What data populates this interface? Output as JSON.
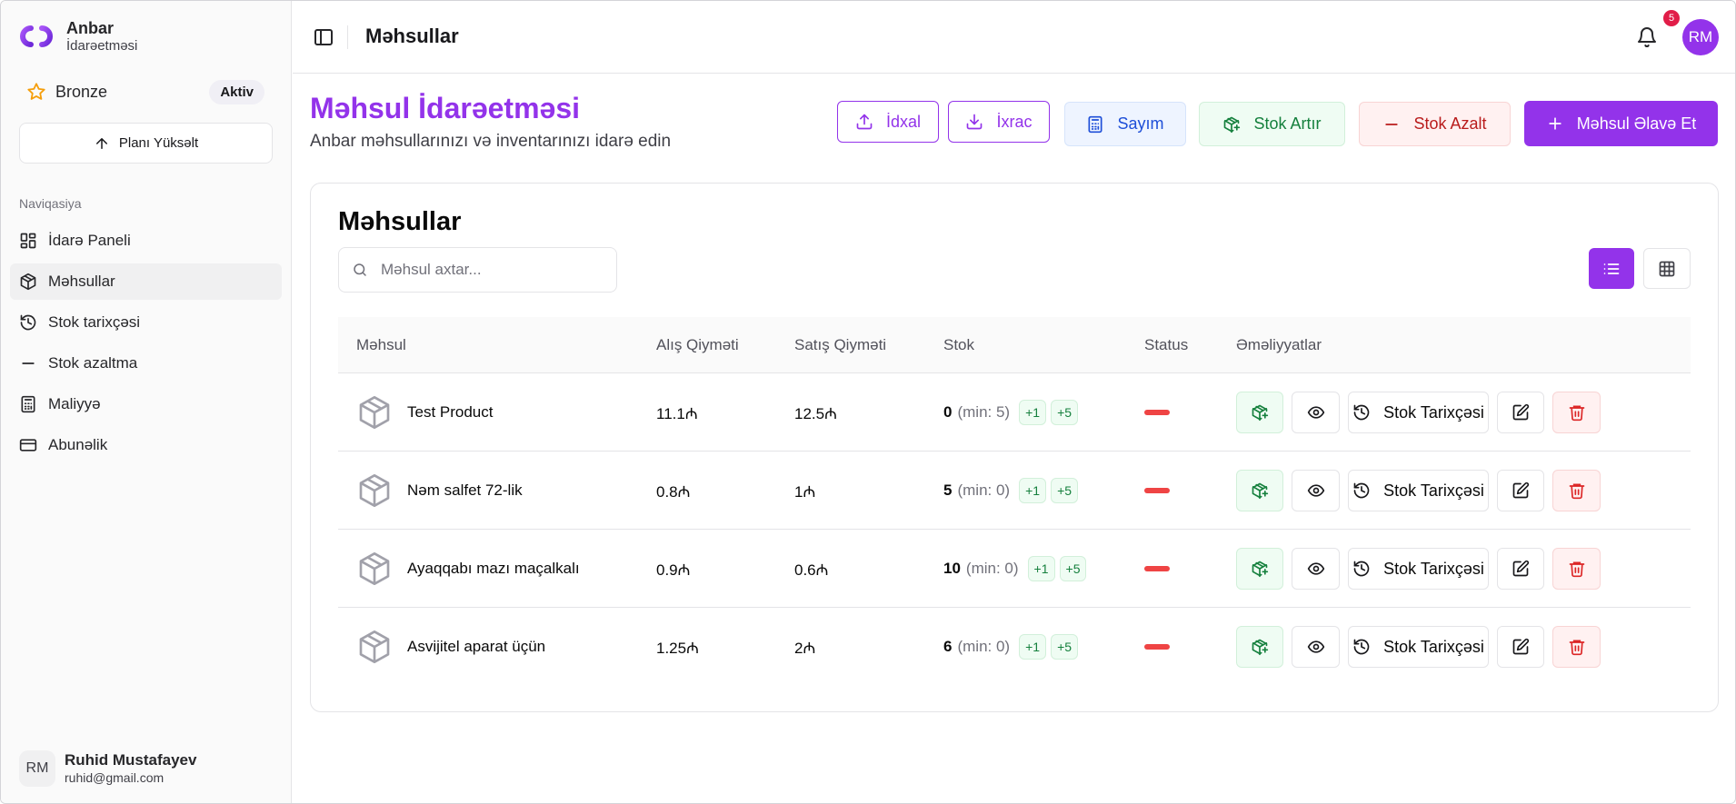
{
  "brand": {
    "title": "Anbar",
    "subtitle": "İdarəetməsi"
  },
  "plan": {
    "name": "Bronze",
    "badge": "Aktiv",
    "upgrade_label": "Planı Yüksəlt"
  },
  "nav": {
    "heading": "Naviqasiya",
    "items": [
      {
        "label": "İdarə Paneli",
        "icon": "dashboard-icon"
      },
      {
        "label": "Məhsullar",
        "icon": "package-icon",
        "active": true
      },
      {
        "label": "Stok tarixçəsi",
        "icon": "history-icon"
      },
      {
        "label": "Stok azaltma",
        "icon": "minus-icon"
      },
      {
        "label": "Maliyyə",
        "icon": "calculator-icon"
      },
      {
        "label": "Abunəlik",
        "icon": "credit-card-icon"
      }
    ]
  },
  "user": {
    "initials": "RM",
    "name": "Ruhid Mustafayev",
    "email": "ruhid@gmail.com"
  },
  "topbar": {
    "title": "Məhsullar",
    "notification_count": "5",
    "avatar_initials": "RM"
  },
  "header": {
    "title": "Məhsul İdarəetməsi",
    "subtitle": "Anbar məhsullarınızı və inventarınızı idarə edin",
    "buttons": {
      "import": "İdxal",
      "export": "İxrac",
      "count": "Sayım",
      "stock_up": "Stok Artır",
      "stock_down": "Stok Azalt",
      "add": "Məhsul Əlavə Et"
    }
  },
  "products": {
    "title": "Məhsullar",
    "search_placeholder": "Məhsul axtar...",
    "columns": [
      "Məhsul",
      "Alış Qiyməti",
      "Satış Qiyməti",
      "Stok",
      "Status",
      "Əməliyyatlar"
    ],
    "history_label": "Stok Tarixçəsi",
    "chip_plus1": "+1",
    "chip_plus5": "+5",
    "rows": [
      {
        "name": "Test Product",
        "buy": "11.1₼",
        "sell": "12.5₼",
        "stock": "0",
        "min": "(min: 5)"
      },
      {
        "name": "Nəm salfet 72-lik",
        "buy": "0.8₼",
        "sell": "1₼",
        "stock": "5",
        "min": "(min: 0)"
      },
      {
        "name": "Ayaqqabı mazı maçalkalı",
        "buy": "0.9₼",
        "sell": "0.6₼",
        "stock": "10",
        "min": "(min: 0)"
      },
      {
        "name": "Asvijitel aparat üçün",
        "buy": "1.25₼",
        "sell": "2₼",
        "stock": "6",
        "min": "(min: 0)"
      }
    ]
  },
  "colors": {
    "accent": "#9333ea",
    "success": "#15803d",
    "danger": "#b91c1c",
    "info": "#1d4ed8",
    "status_low": "#ef4444"
  }
}
